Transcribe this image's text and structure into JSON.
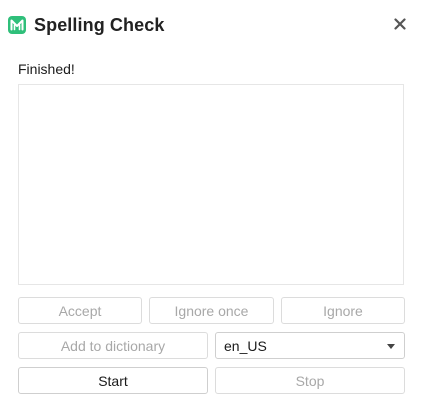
{
  "window": {
    "title": "Spelling Check",
    "close_icon": "close-icon",
    "app_icon": "app-logo-icon",
    "accent_color": "#2fbf7a"
  },
  "status": "Finished!",
  "buttons": {
    "accept": "Accept",
    "ignore_once": "Ignore once",
    "ignore": "Ignore",
    "add_to_dictionary": "Add to dictionary",
    "start": "Start",
    "stop": "Stop"
  },
  "language_select": {
    "value": "en_US"
  }
}
